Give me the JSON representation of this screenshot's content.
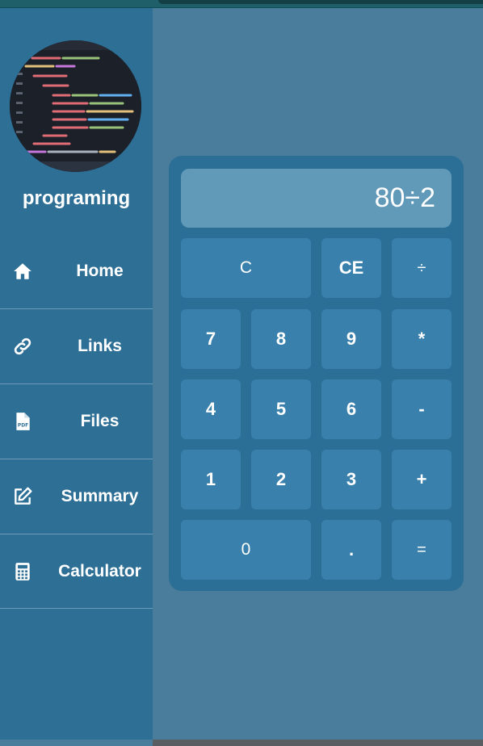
{
  "profile": {
    "name": "programing"
  },
  "nav": [
    {
      "label": "Home",
      "icon": "home-icon"
    },
    {
      "label": "Links",
      "icon": "link-icon"
    },
    {
      "label": "Files",
      "icon": "pdf-file-icon"
    },
    {
      "label": "Summary",
      "icon": "edit-icon"
    },
    {
      "label": "Calculator",
      "icon": "calculator-icon"
    }
  ],
  "calculator": {
    "display": "80÷2",
    "keys": {
      "clear": "C",
      "clear_entry": "CE",
      "divide": "÷",
      "seven": "7",
      "eight": "8",
      "nine": "9",
      "multiply": "*",
      "four": "4",
      "five": "5",
      "six": "6",
      "minus": "-",
      "one": "1",
      "two": "2",
      "three": "3",
      "plus": "+",
      "zero": "0",
      "dot": ".",
      "equals": "="
    }
  },
  "colors": {
    "sidebar": "#2e6f96",
    "main_background": "#4a7d9c",
    "calculator_body": "#2b6f96",
    "calculator_key": "#3a80ad",
    "calculator_display": "#6199b8"
  }
}
